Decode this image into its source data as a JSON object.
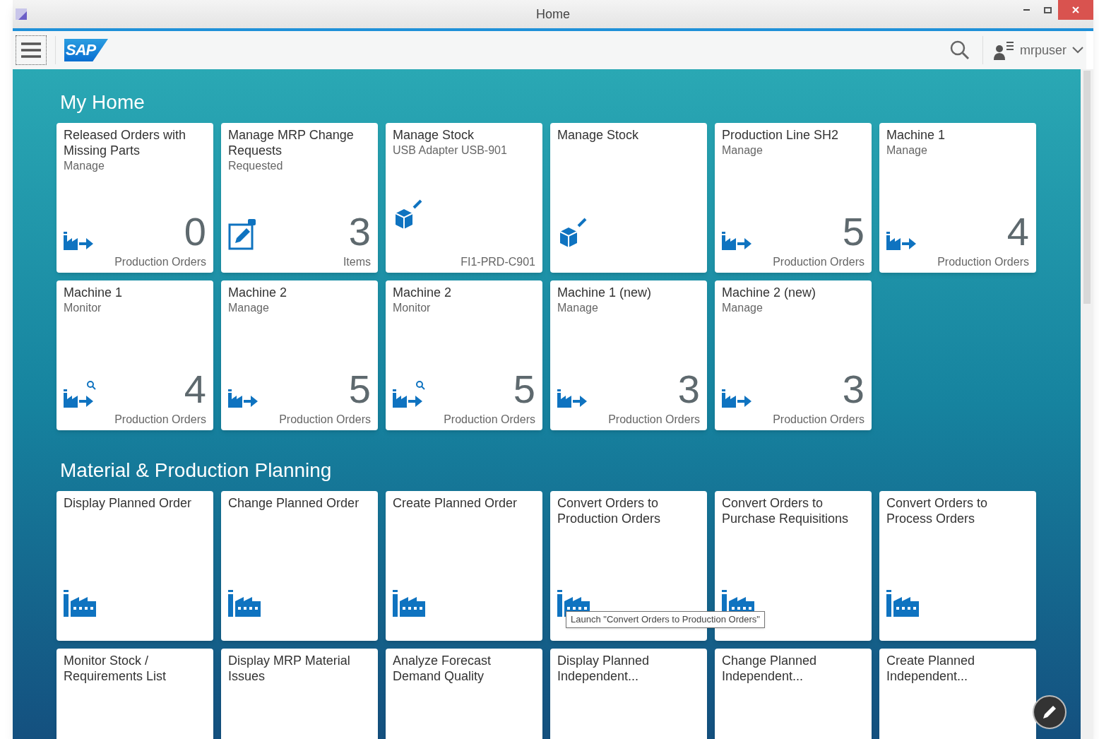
{
  "window": {
    "title": "Home"
  },
  "header": {
    "logo": "SAP",
    "user": "mrpuser"
  },
  "sections": [
    {
      "title": "My Home",
      "tiles": [
        {
          "title": "Released Orders with Missing Parts",
          "subtitle": "Manage",
          "kind": "factory-arrow",
          "number": "0",
          "footer": "Production Orders"
        },
        {
          "title": "Manage MRP Change Requests",
          "subtitle": "Requested",
          "kind": "edit",
          "number": "3",
          "footer": "Items"
        },
        {
          "title": "Manage Stock",
          "subtitle": "USB Adapter USB-901",
          "kind": "cube",
          "footer": "FI1-PRD-C901"
        },
        {
          "title": "Manage Stock",
          "kind": "cube"
        },
        {
          "title": "Production Line SH2",
          "subtitle": "Manage",
          "kind": "factory-arrow",
          "number": "5",
          "footer": "Production Orders"
        },
        {
          "title": "Machine 1",
          "subtitle": "Manage",
          "kind": "factory-arrow",
          "number": "4",
          "footer": "Production Orders"
        },
        {
          "title": "Machine 1",
          "subtitle": "Monitor",
          "kind": "factory-monitor",
          "number": "4",
          "footer": "Production Orders"
        },
        {
          "title": "Machine 2",
          "subtitle": "Manage",
          "kind": "factory-arrow",
          "number": "5",
          "footer": "Production Orders"
        },
        {
          "title": "Machine 2",
          "subtitle": "Monitor",
          "kind": "factory-monitor",
          "number": "5",
          "footer": "Production Orders"
        },
        {
          "title": "Machine 1 (new)",
          "subtitle": "Manage",
          "kind": "factory-arrow",
          "number": "3",
          "footer": "Production Orders"
        },
        {
          "title": "Machine 2 (new)",
          "subtitle": "Manage",
          "kind": "factory-arrow",
          "number": "3",
          "footer": "Production Orders"
        }
      ]
    },
    {
      "title": "Material & Production Planning",
      "tiles": [
        {
          "title": "Display Planned Order",
          "kind": "factory"
        },
        {
          "title": "Change Planned Order",
          "kind": "factory"
        },
        {
          "title": "Create Planned Order",
          "kind": "factory"
        },
        {
          "title": "Convert Orders to Production Orders",
          "kind": "factory",
          "tooltip": "Launch \"Convert Orders to Production Orders\""
        },
        {
          "title": "Convert Orders to Purchase Requisitions",
          "kind": "factory"
        },
        {
          "title": "Convert Orders to Process Orders",
          "kind": "factory"
        },
        {
          "title": "Monitor Stock / Requirements List"
        },
        {
          "title": "Display MRP Material Issues"
        },
        {
          "title": "Analyze Forecast Demand Quality"
        },
        {
          "title": "Display Planned Independent..."
        },
        {
          "title": "Change Planned Independent..."
        },
        {
          "title": "Create Planned Independent..."
        }
      ]
    }
  ]
}
